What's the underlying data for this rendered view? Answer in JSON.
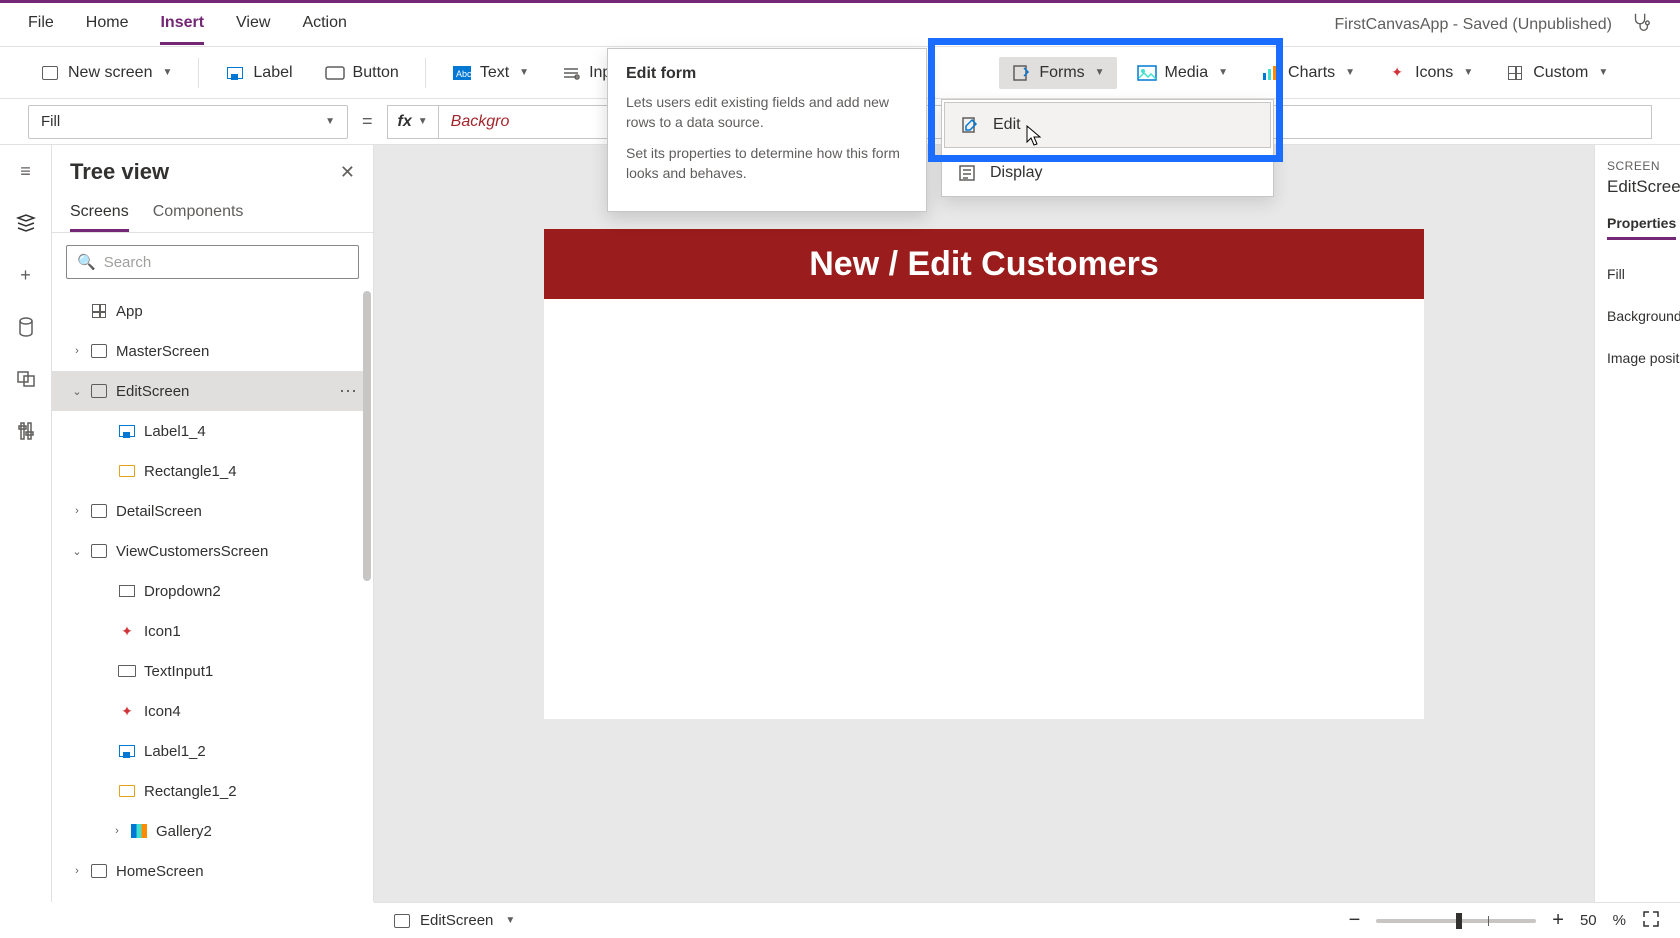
{
  "menu": {
    "items": [
      "File",
      "Home",
      "Insert",
      "View",
      "Action"
    ],
    "activeIndex": 2
  },
  "appStatus": "FirstCanvasApp - Saved (Unpublished)",
  "ribbon": {
    "newScreen": "New screen",
    "label": "Label",
    "button": "Button",
    "text": "Text",
    "input": "Inp",
    "forms": "Forms",
    "media": "Media",
    "charts": "Charts",
    "icons": "Icons",
    "custom": "Custom"
  },
  "formula": {
    "prop": "Fill",
    "value": "Backgro"
  },
  "tree": {
    "title": "Tree view",
    "tabs": [
      "Screens",
      "Components"
    ],
    "searchPlaceholder": "Search",
    "items": [
      {
        "name": "App",
        "type": "app",
        "indent": 0
      },
      {
        "name": "MasterScreen",
        "type": "screen",
        "indent": 1,
        "chev": "›"
      },
      {
        "name": "EditScreen",
        "type": "screen",
        "indent": 1,
        "chev": "⌄",
        "selected": true,
        "more": true
      },
      {
        "name": "Label1_4",
        "type": "label",
        "indent": 2
      },
      {
        "name": "Rectangle1_4",
        "type": "rect",
        "indent": 2
      },
      {
        "name": "DetailScreen",
        "type": "screen",
        "indent": 1,
        "chev": "›"
      },
      {
        "name": "ViewCustomersScreen",
        "type": "screen",
        "indent": 1,
        "chev": "⌄"
      },
      {
        "name": "Dropdown2",
        "type": "dd",
        "indent": 2
      },
      {
        "name": "Icon1",
        "type": "icon",
        "indent": 2
      },
      {
        "name": "TextInput1",
        "type": "input",
        "indent": 2
      },
      {
        "name": "Icon4",
        "type": "icon",
        "indent": 2
      },
      {
        "name": "Label1_2",
        "type": "label",
        "indent": 2
      },
      {
        "name": "Rectangle1_2",
        "type": "rect",
        "indent": 2
      },
      {
        "name": "Gallery2",
        "type": "gallery",
        "indent": 3,
        "chev": "›"
      },
      {
        "name": "HomeScreen",
        "type": "screen",
        "indent": 1,
        "chev": "›"
      }
    ]
  },
  "canvas": {
    "headerText": "New / Edit Customers"
  },
  "formsDropdown": {
    "items": [
      "Edit",
      "Display"
    ]
  },
  "tooltip": {
    "title": "Edit form",
    "body1": "Lets users edit existing fields and add new rows to a data source.",
    "body2": "Set its properties to determine how this form looks and behaves."
  },
  "rightPanel": {
    "label": "SCREEN",
    "title": "EditScreen",
    "tab": "Properties",
    "props": [
      "Fill",
      "Background",
      "Image positi"
    ]
  },
  "status": {
    "breadcrumb": "EditScreen",
    "zoom": "50",
    "zoomUnit": "%"
  }
}
